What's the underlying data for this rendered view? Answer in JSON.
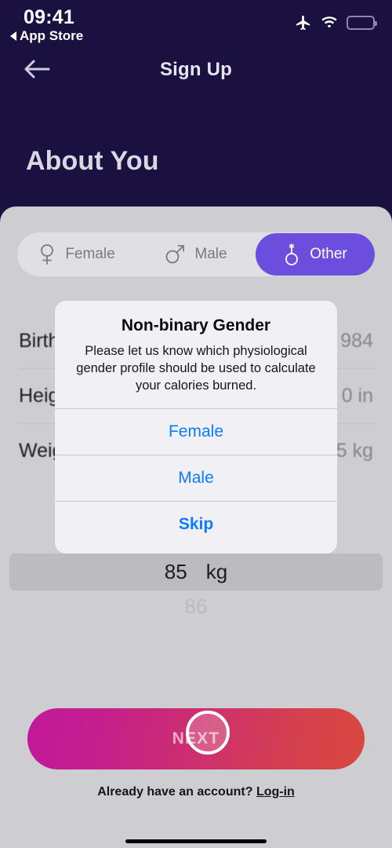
{
  "status_bar": {
    "time": "09:41",
    "back_app": "App Store",
    "icons": [
      "airplane-mode-icon",
      "wifi-icon",
      "battery-low-power-icon"
    ]
  },
  "nav_bar": {
    "back_icon": "arrow-left-icon",
    "title": "Sign Up"
  },
  "page": {
    "heading": "About You"
  },
  "gender_segment": {
    "options": [
      {
        "label": "Female",
        "icon": "female-symbol-icon",
        "selected": false
      },
      {
        "label": "Male",
        "icon": "male-symbol-icon",
        "selected": false
      },
      {
        "label": "Other",
        "icon": "non-binary-symbol-icon",
        "selected": true
      }
    ]
  },
  "form_rows": [
    {
      "label": "Birthday",
      "label_visible": "Birth",
      "value_visible": "984"
    },
    {
      "label": "Height",
      "label_visible": "Heig",
      "value_visible": "0 in"
    },
    {
      "label": "Weight",
      "label_visible": "Weig",
      "value_visible": "5 kg"
    }
  ],
  "weight_picker": {
    "selected_value": "85",
    "unit": "kg",
    "next_value": "86"
  },
  "alert": {
    "title": "Non-binary Gender",
    "message": "Please let us know which physiological gender profile should be used to calculate your calories burned.",
    "buttons": [
      {
        "label": "Female",
        "emphasized": false
      },
      {
        "label": "Male",
        "emphasized": false
      },
      {
        "label": "Skip",
        "emphasized": true
      }
    ]
  },
  "footer": {
    "next_label": "NEXT",
    "account_prompt": "Already have an account?",
    "login_label": "Log-in"
  },
  "colors": {
    "header_navy": "#1b1140",
    "accent_purple": "#6c4ede",
    "alert_blue": "#0a7cff",
    "battery_yellow": "#f4d800",
    "gradient_start": "#c2189b",
    "gradient_end": "#d9483f"
  }
}
